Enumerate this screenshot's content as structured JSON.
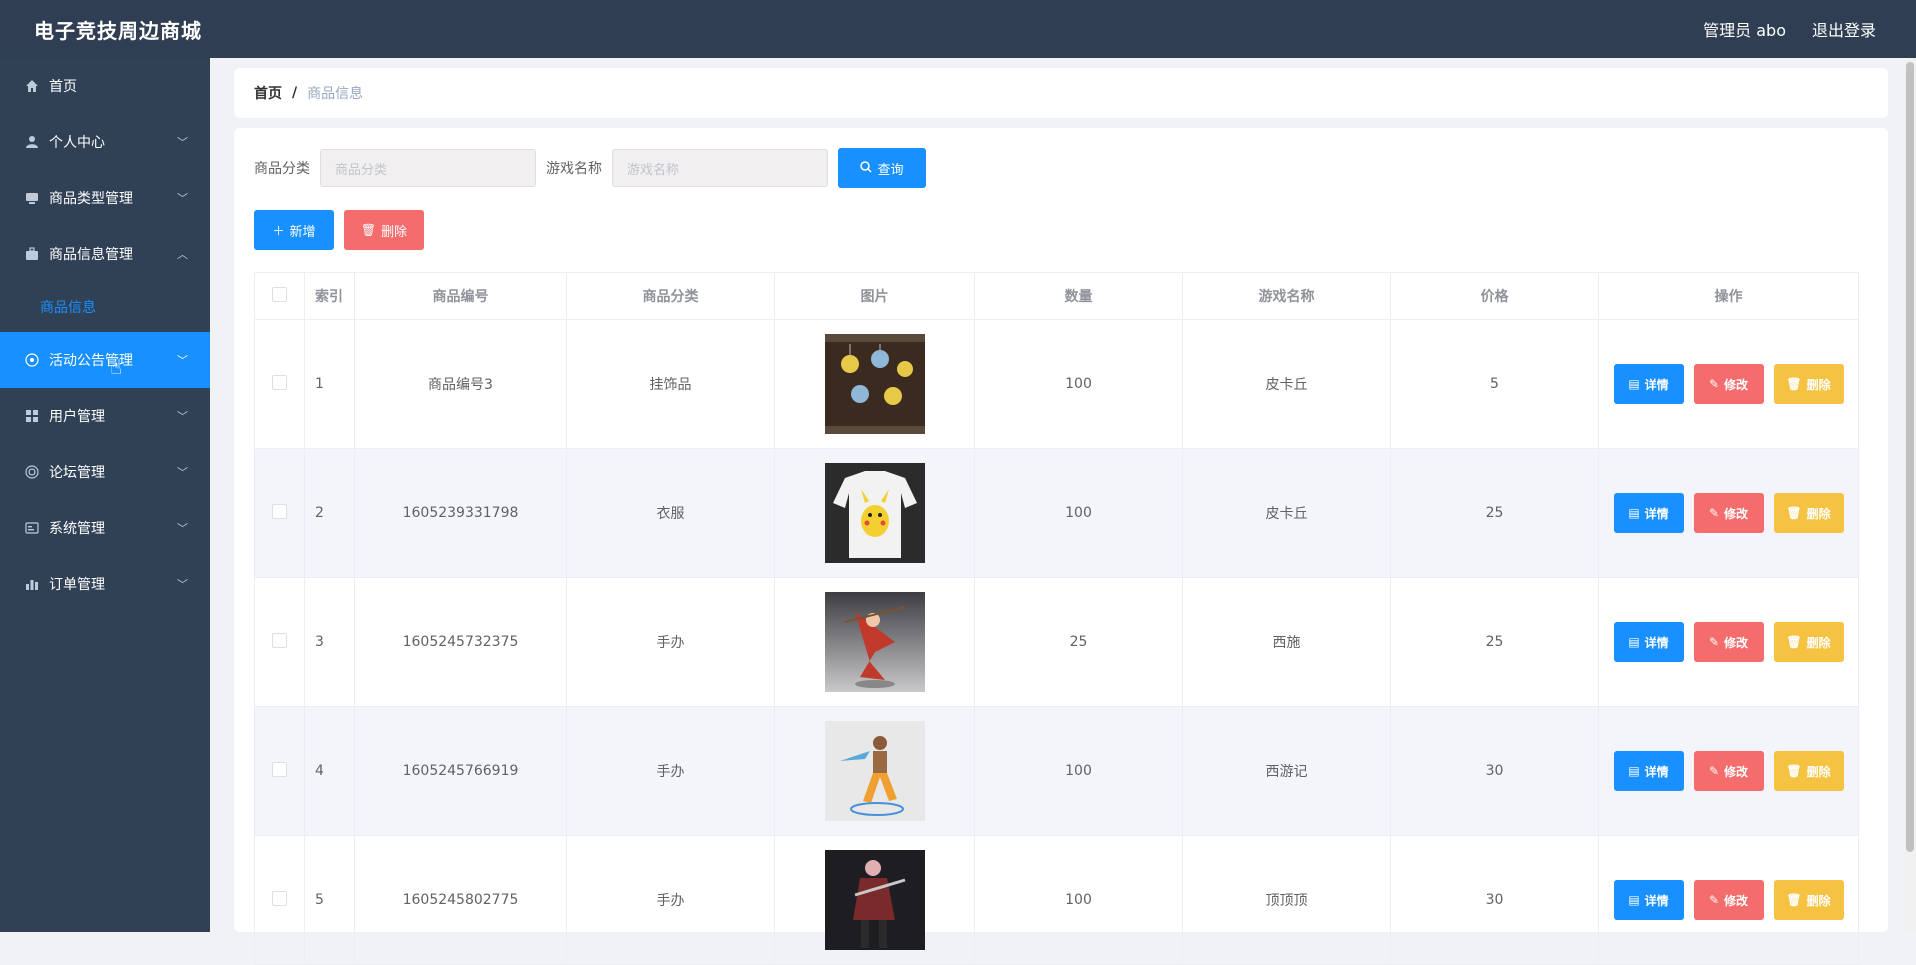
{
  "header": {
    "title": "电子竞技周边商城",
    "user": "管理员 abo",
    "logout": "退出登录"
  },
  "sidebar": {
    "items": [
      {
        "label": "首页",
        "icon": "home-icon",
        "has_children": false
      },
      {
        "label": "个人中心",
        "icon": "user-icon",
        "has_children": true
      },
      {
        "label": "商品类型管理",
        "icon": "monitor-icon",
        "has_children": true
      },
      {
        "label": "商品信息管理",
        "icon": "briefcase-icon",
        "has_children": true,
        "expanded": true
      },
      {
        "label": "活动公告管理",
        "icon": "target-icon",
        "has_children": true,
        "active": true
      },
      {
        "label": "用户管理",
        "icon": "grid-icon",
        "has_children": true
      },
      {
        "label": "论坛管理",
        "icon": "lifebuoy-icon",
        "has_children": true
      },
      {
        "label": "系统管理",
        "icon": "id-card-icon",
        "has_children": true
      },
      {
        "label": "订单管理",
        "icon": "bar-chart-icon",
        "has_children": true
      }
    ],
    "submenu": {
      "label": "商品信息"
    }
  },
  "breadcrumb": {
    "home": "首页",
    "sep": "/",
    "current": "商品信息"
  },
  "search": {
    "category_label": "商品分类",
    "category_placeholder": "商品分类",
    "game_label": "游戏名称",
    "game_placeholder": "游戏名称",
    "query": "查询"
  },
  "actions": {
    "add": "新增",
    "delete": "删除"
  },
  "table": {
    "headers": [
      "索引",
      "商品编号",
      "商品分类",
      "图片",
      "数量",
      "游戏名称",
      "价格",
      "操作"
    ],
    "rows": [
      {
        "index": "1",
        "code": "商品编号3",
        "category": "挂饰品",
        "qty": "100",
        "game": "皮卡丘",
        "price": "5"
      },
      {
        "index": "2",
        "code": "1605239331798",
        "category": "衣服",
        "qty": "100",
        "game": "皮卡丘",
        "price": "25"
      },
      {
        "index": "3",
        "code": "1605245732375",
        "category": "手办",
        "qty": "25",
        "game": "西施",
        "price": "25"
      },
      {
        "index": "4",
        "code": "1605245766919",
        "category": "手办",
        "qty": "100",
        "game": "西游记",
        "price": "30"
      },
      {
        "index": "5",
        "code": "1605245802775",
        "category": "手办",
        "qty": "100",
        "game": "顶顶顶",
        "price": "30"
      }
    ],
    "ops": {
      "detail": "详情",
      "edit": "修改",
      "delete": "删除"
    }
  },
  "colors": {
    "primary": "#1890ff",
    "danger": "#f56c6c",
    "warning": "#f5c242",
    "sidebar": "#304156",
    "header": "#2f3e52"
  }
}
